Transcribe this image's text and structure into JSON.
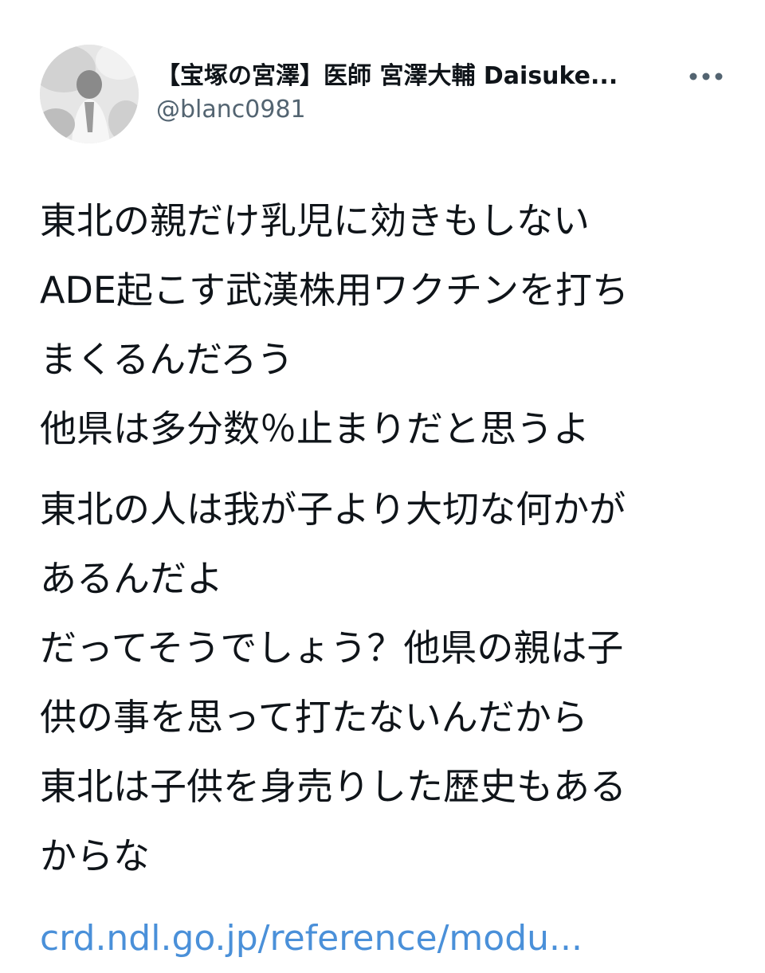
{
  "author": {
    "display_name": "【宝塚の宮澤】医師 宮澤大輔 Daisuke...",
    "handle": "@blanc0981",
    "avatar_icon": "profile-photo-icon"
  },
  "menu": {
    "icon": "more-options-icon"
  },
  "tweet": {
    "paragraphs": [
      {
        "lines": [
          "東北の親だけ乳児に効きもしない",
          "ADE起こす武漢株用ワクチンを打ち",
          "まくるんだろう",
          "他県は多分数％止まりだと思うよ"
        ]
      },
      {
        "lines": [
          "東北の人は我が子より大切な何かが",
          "あるんだよ",
          "だってそうでしょう？他県の親は子",
          "供の事を思って打たないんだから",
          "東北は子供を身売りした歴史もある",
          "からな"
        ]
      }
    ],
    "link_text": "crd.ndl.go.jp/reference/modu..."
  },
  "colors": {
    "text": "#0f1419",
    "secondary": "#536471",
    "link": "#4a90d9",
    "background": "#ffffff"
  }
}
